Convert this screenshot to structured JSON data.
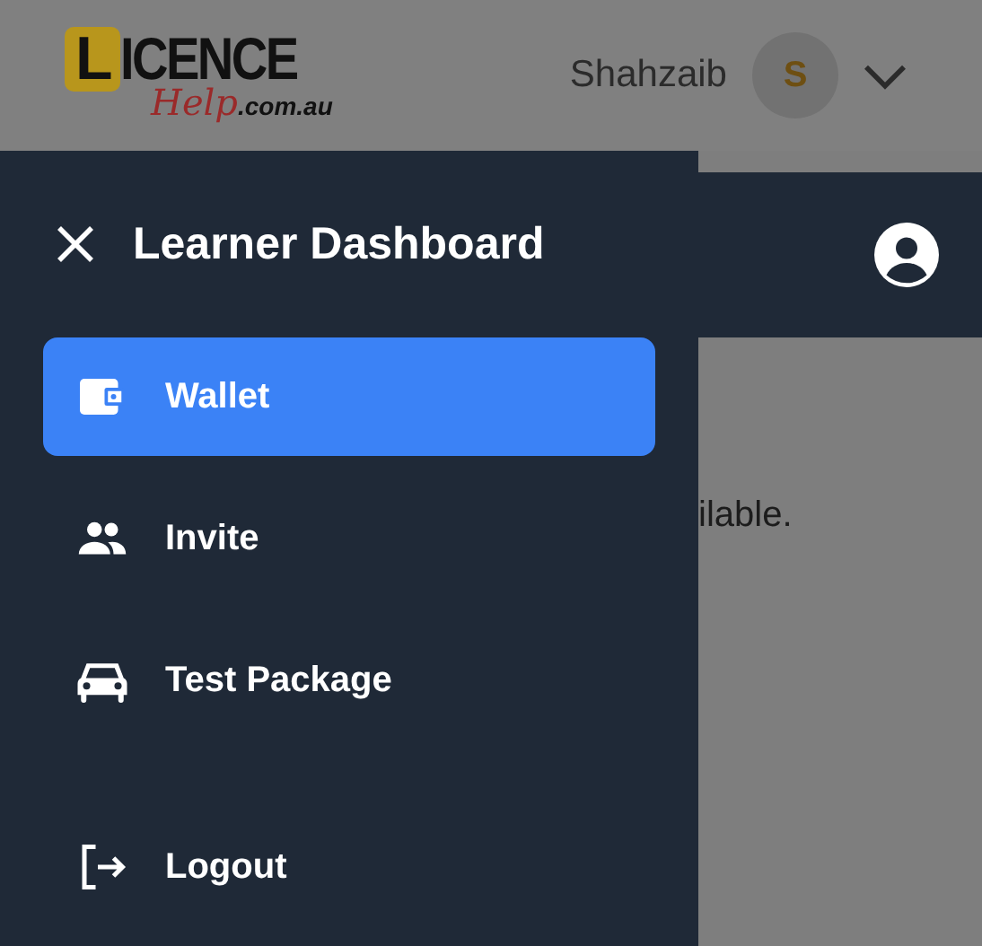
{
  "header": {
    "logo": {
      "letter": "L",
      "word": "ICENCE",
      "script": "Help",
      "domain": ".com.au"
    },
    "user_name": "Shahzaib",
    "avatar_initial": "S"
  },
  "drawer": {
    "title": "Learner Dashboard",
    "items": [
      {
        "label": "Wallet",
        "kind": "wallet",
        "selected": true
      },
      {
        "label": "Invite",
        "kind": "people",
        "selected": false
      },
      {
        "label": "Test Package",
        "kind": "car",
        "selected": false
      }
    ],
    "logout": {
      "label": "Logout"
    }
  },
  "background": {
    "text": "ilable."
  }
}
